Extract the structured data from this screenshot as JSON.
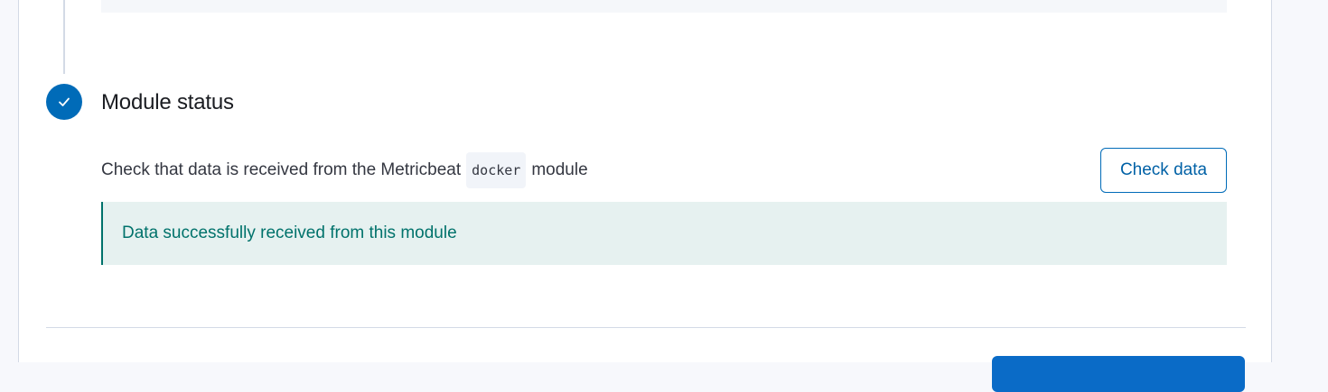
{
  "step": {
    "title": "Module status",
    "description_prefix": "Check that data is received from the Metricbeat",
    "module_code": "docker",
    "description_suffix": "module",
    "check_button_label": "Check data",
    "status_message": "Data successfully received from this module",
    "icon": "check-icon"
  },
  "colors": {
    "accent": "#006bb8",
    "success_text": "#00726b",
    "success_bg": "#e6f1f0"
  }
}
